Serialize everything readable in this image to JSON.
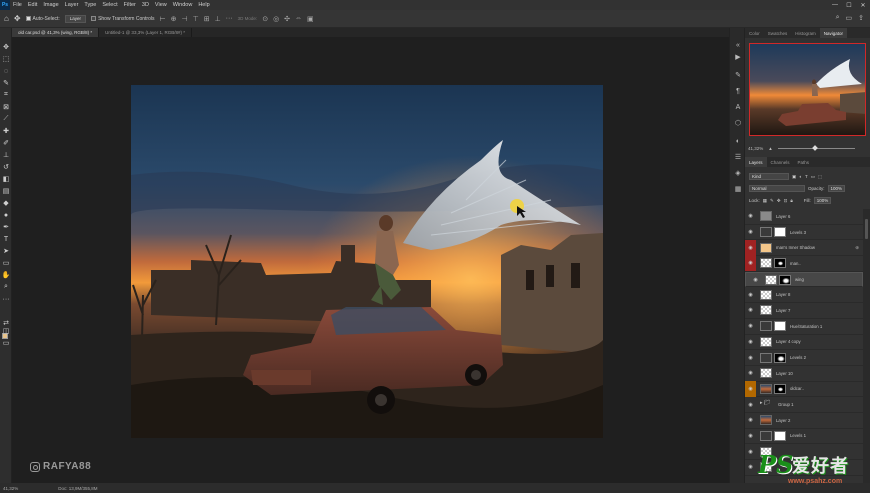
{
  "menu": {
    "logo": "Ps",
    "items": [
      "File",
      "Edit",
      "Image",
      "Layer",
      "Type",
      "Select",
      "Filter",
      "3D",
      "View",
      "Window",
      "Help"
    ],
    "window_controls": [
      "—",
      "☐",
      "✕"
    ]
  },
  "options": {
    "auto_select_label": "Auto-Select:",
    "auto_select_value": "Layer",
    "show_transform_label": "Show Transform Controls",
    "mode_3d_label": "3D Mode:"
  },
  "doc_tabs": [
    {
      "label": "old car.psd @ 41,3% (wing, RGB/8) *",
      "active": true
    },
    {
      "label": "Untitled-1 @ 33,3% (Layer 1, RGB/8#) *",
      "active": false
    }
  ],
  "status": {
    "zoom": "41,32%",
    "doc": "Doc: 13,9M/355,8M"
  },
  "watermark": {
    "handle": "RAFYA88"
  },
  "panel": {
    "top_tabs": [
      "Color",
      "Swatches",
      "Histogram",
      "Navigator"
    ],
    "nav_zoom": "41,32%",
    "layer_tabs": [
      "Layers",
      "Channels",
      "Paths"
    ],
    "filter_kind": "Kind",
    "blend_mode": "Normal",
    "opacity_label": "Opacity:",
    "opacity_value": "100%",
    "lock_label": "Lock:",
    "fill_label": "Fill:",
    "fill_value": "100%"
  },
  "layers": [
    {
      "name": "Layer 6",
      "thumb": "gray",
      "mask": false,
      "eye": "normal",
      "selected": false,
      "fx": false
    },
    {
      "name": "Levels 3",
      "thumb": "adj",
      "mask": true,
      "eye": "normal",
      "selected": false,
      "fx": false
    },
    {
      "name": "man's Inner Shadow",
      "thumb": "peach",
      "mask": false,
      "eye": "red",
      "selected": false,
      "fx": true
    },
    {
      "name": "man..",
      "thumb": "checker",
      "mask": "black",
      "eye": "red",
      "selected": false,
      "fx": false
    },
    {
      "name": "wing",
      "thumb": "checker",
      "mask": "dark",
      "eye": "normal",
      "selected": true,
      "fx": false
    },
    {
      "name": "Layer 8",
      "thumb": "checker",
      "mask": false,
      "eye": "normal",
      "selected": false,
      "fx": false
    },
    {
      "name": "Layer 7",
      "thumb": "checker",
      "mask": false,
      "eye": "normal",
      "selected": false,
      "fx": false
    },
    {
      "name": "Hue/Saturation 1",
      "thumb": "adj",
      "mask": true,
      "eye": "normal",
      "selected": false,
      "fx": false
    },
    {
      "name": "Layer 4 copy",
      "thumb": "checker",
      "mask": false,
      "eye": "normal",
      "selected": false,
      "fx": false
    },
    {
      "name": "Levels 2",
      "thumb": "adj",
      "mask": "dark",
      "eye": "normal",
      "selected": false,
      "fx": false
    },
    {
      "name": "Layer 10",
      "thumb": "checker",
      "mask": false,
      "eye": "normal",
      "selected": false,
      "fx": false
    },
    {
      "name": "oldcar..",
      "thumb": "photo",
      "mask": "black",
      "eye": "orange",
      "selected": false,
      "fx": false
    },
    {
      "name": "Group 1",
      "thumb": "folder",
      "mask": false,
      "eye": "normal",
      "selected": false,
      "fx": false
    },
    {
      "name": "Layer 2",
      "thumb": "photo",
      "mask": false,
      "eye": "normal",
      "selected": false,
      "fx": false
    },
    {
      "name": "Levels 1",
      "thumb": "adj",
      "mask": true,
      "eye": "normal",
      "selected": false,
      "fx": false
    },
    {
      "name": "",
      "thumb": "checker",
      "mask": false,
      "eye": "normal",
      "selected": false,
      "fx": false
    },
    {
      "name": "",
      "thumb": "checker",
      "mask": false,
      "eye": "normal",
      "selected": false,
      "fx": false
    }
  ],
  "logo": {
    "ps": "PS",
    "cn": "爱好者",
    "url": "www.psahz.com"
  }
}
